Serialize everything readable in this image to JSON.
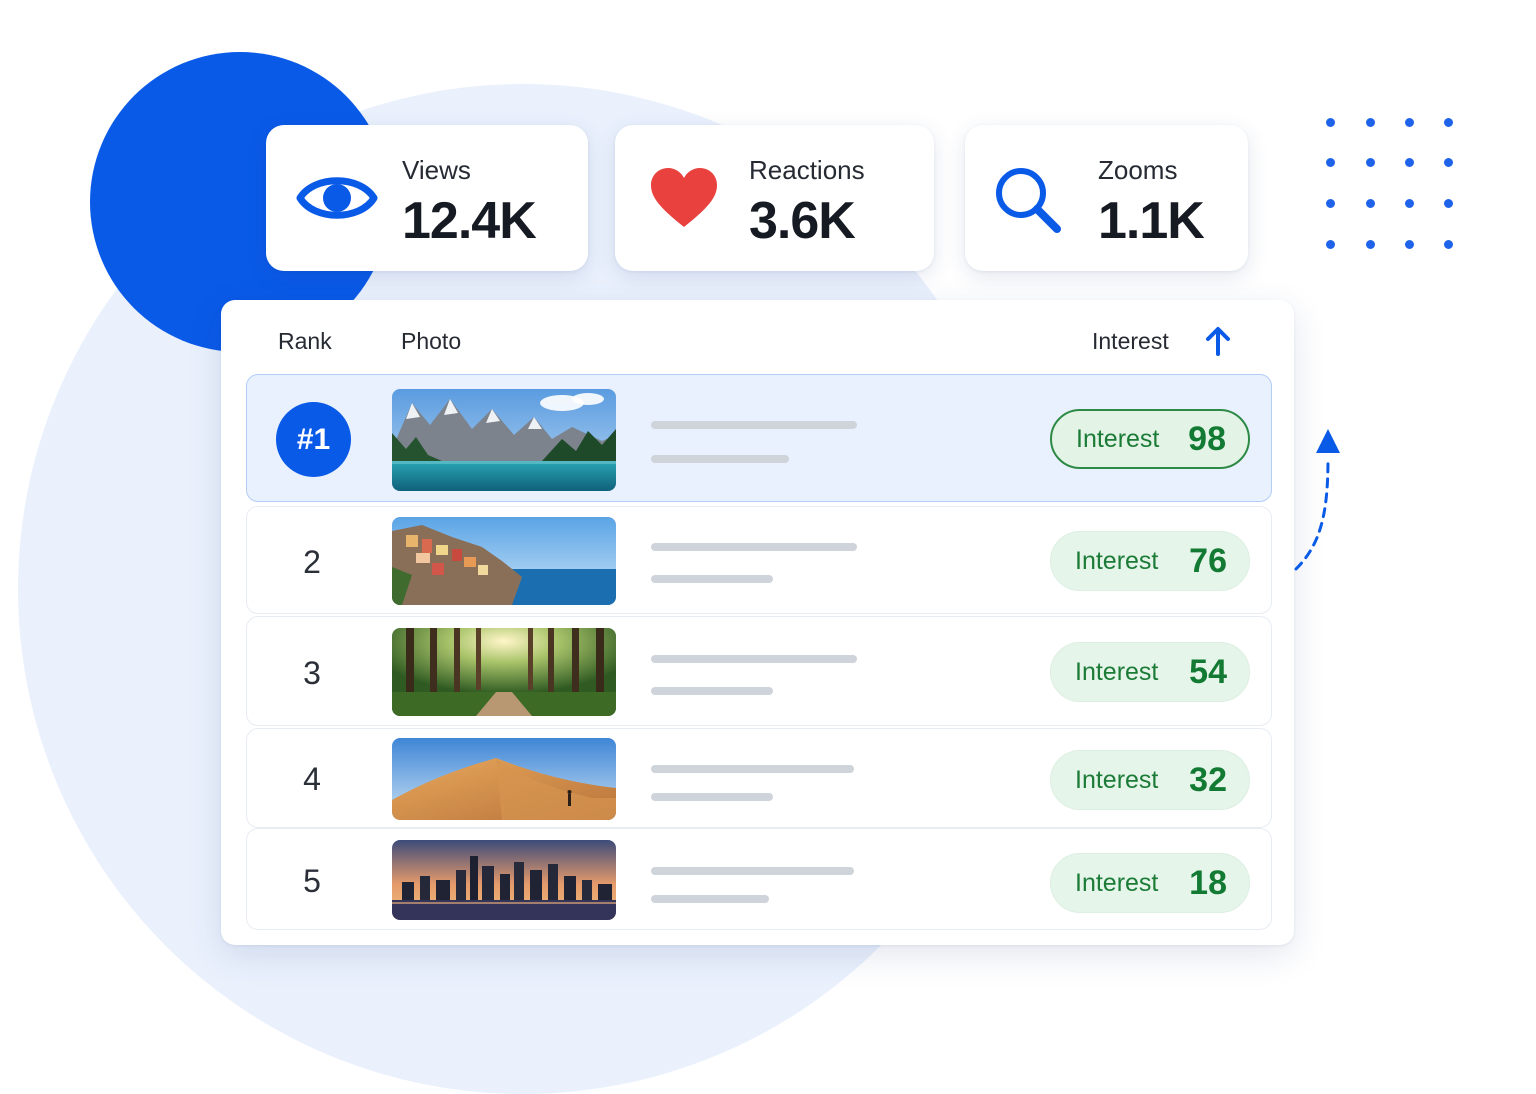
{
  "stats": [
    {
      "label": "Views",
      "value": "12.4K",
      "icon": "eye-icon"
    },
    {
      "label": "Reactions",
      "value": "3.6K",
      "icon": "heart-icon"
    },
    {
      "label": "Zooms",
      "value": "1.1K",
      "icon": "search-icon"
    }
  ],
  "table": {
    "headers": {
      "rank": "Rank",
      "photo": "Photo",
      "interest": "Interest"
    },
    "sort_icon": "arrow-up-icon",
    "pill_label": "Interest",
    "rows": [
      {
        "rank": "#1",
        "photo": "mountain-lake",
        "interest": "98",
        "interest_value": 98
      },
      {
        "rank": "2",
        "photo": "cliffside-village",
        "interest": "76",
        "interest_value": 76
      },
      {
        "rank": "3",
        "photo": "forest-path",
        "interest": "54",
        "interest_value": 54
      },
      {
        "rank": "4",
        "photo": "desert-dunes",
        "interest": "32",
        "interest_value": 32
      },
      {
        "rank": "5",
        "photo": "city-skyline-sunset",
        "interest": "18",
        "interest_value": 18
      }
    ]
  },
  "colors": {
    "accent": "#0a5ae8",
    "interest_text": "#137a33",
    "interest_bg": "#e6f5ea",
    "heart": "#e8413e"
  }
}
